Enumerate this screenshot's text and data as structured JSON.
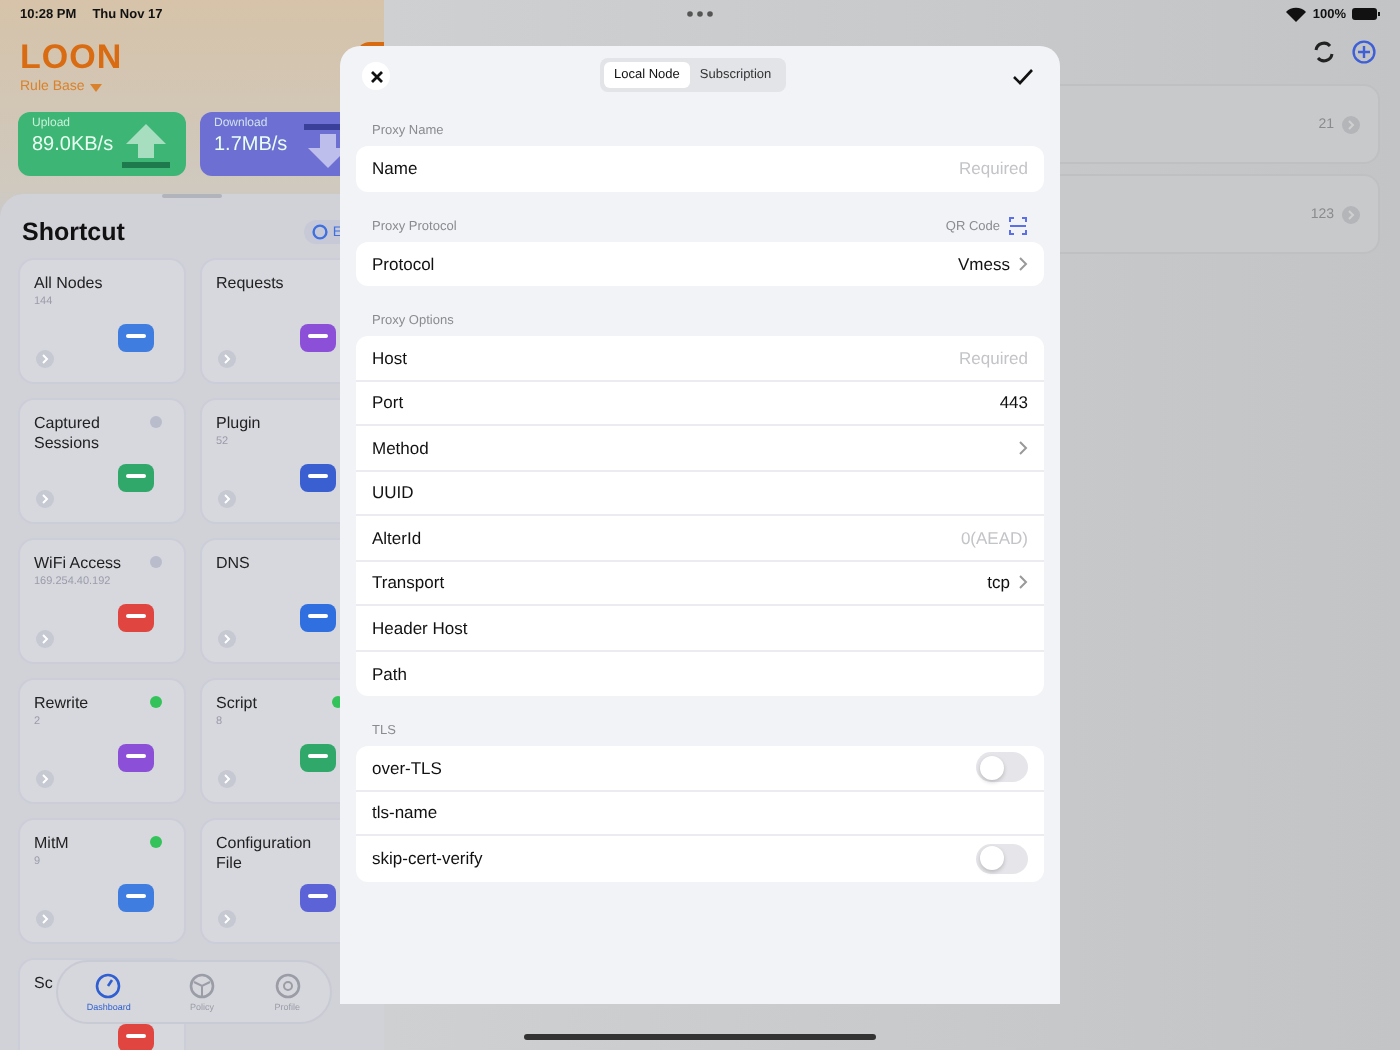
{
  "status_bar": {
    "time": "10:28 PM",
    "date": "Thu Nov 17",
    "battery": "100%"
  },
  "app": {
    "title": "LOON",
    "mode": "Rule Base",
    "enabled": true
  },
  "stats": [
    {
      "label": "Upload",
      "value": "89.0KB/s",
      "kind": "upload"
    },
    {
      "label": "Download",
      "value": "1.7MB/s",
      "kind": "download"
    }
  ],
  "shortcut": {
    "title": "Shortcut",
    "edit_label": "E",
    "cards": [
      {
        "title": "All Nodes",
        "count": "144"
      },
      {
        "title": "Requests"
      },
      {
        "title": "Captured Sessions",
        "on": false
      },
      {
        "title": "Plugin",
        "count": "52"
      },
      {
        "title": "WiFi Access",
        "count": "169.254.40.192",
        "on": false
      },
      {
        "title": "DNS"
      },
      {
        "title": "Rewrite",
        "count": "2",
        "on": true
      },
      {
        "title": "Script",
        "count": "8",
        "on": true
      },
      {
        "title": "MitM",
        "count": "9",
        "on": true
      },
      {
        "title": "Configuration File"
      },
      {
        "title": "Sc"
      }
    ]
  },
  "tab_bar": [
    {
      "label": "Dashboard",
      "selected": true
    },
    {
      "label": "Policy",
      "selected": false
    },
    {
      "label": "Profile",
      "selected": false
    }
  ],
  "background_list": [
    {
      "count": "21"
    },
    {
      "count": "123"
    }
  ],
  "sheet": {
    "segments": [
      {
        "label": "Local Node",
        "selected": true
      },
      {
        "label": "Subscription",
        "selected": false
      }
    ],
    "sections": [
      {
        "title": "Proxy Name",
        "rows": [
          {
            "kind": "input",
            "label": "Name",
            "placeholder": "Required"
          }
        ]
      },
      {
        "title": "Proxy Protocol",
        "action": "QR Code",
        "rows": [
          {
            "kind": "select",
            "label": "Protocol",
            "value": "Vmess"
          }
        ]
      },
      {
        "title": "Proxy Options",
        "rows": [
          {
            "kind": "input",
            "label": "Host",
            "placeholder": "Required"
          },
          {
            "kind": "input",
            "label": "Port",
            "value": "443"
          },
          {
            "kind": "select",
            "label": "Method"
          },
          {
            "kind": "input",
            "label": "UUID"
          },
          {
            "kind": "input",
            "label": "AlterId",
            "placeholder": "0(AEAD)"
          },
          {
            "kind": "select",
            "label": "Transport",
            "value": "tcp"
          },
          {
            "kind": "input",
            "label": "Header Host"
          },
          {
            "kind": "input",
            "label": "Path"
          }
        ]
      },
      {
        "title": "TLS",
        "rows": [
          {
            "kind": "toggle",
            "label": "over-TLS",
            "on": false
          },
          {
            "kind": "input",
            "label": "tls-name"
          },
          {
            "kind": "toggle",
            "label": "skip-cert-verify",
            "on": false
          }
        ]
      }
    ]
  }
}
